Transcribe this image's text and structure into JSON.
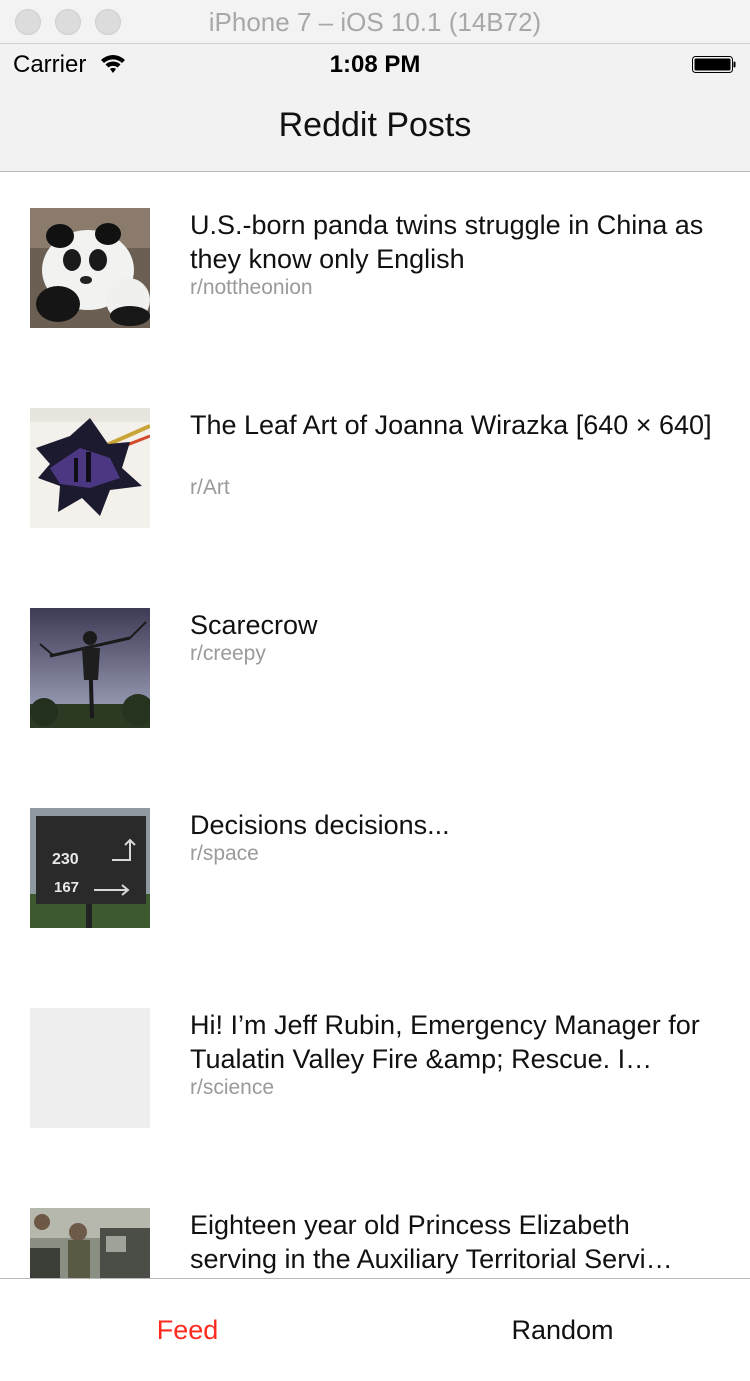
{
  "window": {
    "title": "iPhone 7 – iOS 10.1 (14B72)"
  },
  "status_bar": {
    "carrier": "Carrier",
    "time": "1:08 PM",
    "wifi_icon": "wifi-icon",
    "battery_icon": "battery-full-icon"
  },
  "nav": {
    "title": "Reddit Posts"
  },
  "posts": [
    {
      "title": "U.S.-born panda twins struggle in China as they know only English",
      "subreddit": "r/nottheonion",
      "thumbnail": "panda-photo"
    },
    {
      "title": "The Leaf Art of Joanna Wirazka [640 × 640]",
      "subreddit": "r/Art",
      "thumbnail": "leaf-art-photo"
    },
    {
      "title": "Scarecrow",
      "subreddit": "r/creepy",
      "thumbnail": "scarecrow-photo"
    },
    {
      "title": "Decisions decisions...",
      "subreddit": "r/space",
      "thumbnail": "sign-photo",
      "sign_numbers": [
        "230",
        "167"
      ]
    },
    {
      "title": "Hi! I’m Jeff Rubin, Emergency Manager for Tualatin Valley Fire &amp; Rescue. I…",
      "subreddit": "r/science",
      "thumbnail": "placeholder"
    },
    {
      "title": "Eighteen year old Princess Elizabeth serving in the Auxiliary Territorial Servi…",
      "subreddit": "",
      "thumbnail": "vintage-truck-photo"
    }
  ],
  "tab_bar": {
    "tabs": [
      {
        "label": "Feed",
        "selected": true
      },
      {
        "label": "Random",
        "selected": false
      }
    ],
    "accent_color": "#ff2a1f"
  }
}
